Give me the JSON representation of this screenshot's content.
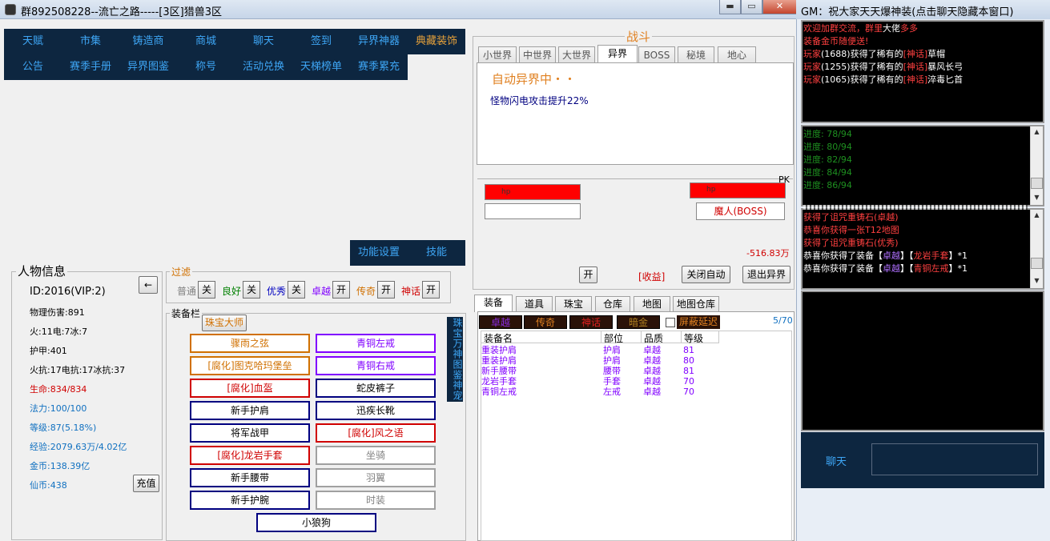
{
  "window": {
    "title": "群892508228--流亡之路-----[3区]猎兽3区",
    "min": "▬",
    "max": "▭",
    "close": "✕"
  },
  "menu": {
    "row1": [
      "天赋",
      "市集",
      "铸造商",
      "商城",
      "聊天",
      "签到",
      "异界神器",
      "典藏装饰"
    ],
    "row2": [
      "公告",
      "赛季手册",
      "异界图鉴",
      "称号",
      "活动兑换",
      "天梯榜单",
      "赛季累充"
    ]
  },
  "func": {
    "settings": "功能设置",
    "skills": "技能"
  },
  "character": {
    "title": "人物信息",
    "back": "←",
    "id": "ID:2016(VIP:2)",
    "phys": "物理伤害:891",
    "elem": "火:11电:7冰:7",
    "armor": "护甲:401",
    "resist": "火抗:17电抗:17冰抗:37",
    "hp": "生命:834/834",
    "mp": "法力:100/100",
    "level": "等级:87(5.18%)",
    "exp": "经验:2079.63万/4.02亿",
    "gold": "金币:138.39亿",
    "coin": "仙币:438",
    "recharge": "充值"
  },
  "filter": {
    "title": "过滤",
    "items": [
      {
        "label": "普通",
        "state": "关",
        "color": "#808080"
      },
      {
        "label": "良好",
        "state": "关",
        "color": "#008000"
      },
      {
        "label": "优秀",
        "state": "关",
        "color": "#0000c0"
      },
      {
        "label": "卓越",
        "state": "开",
        "color": "#8000ff"
      },
      {
        "label": "传奇",
        "state": "开",
        "color": "#d07000"
      },
      {
        "label": "神话",
        "state": "开",
        "color": "#d00000"
      }
    ]
  },
  "equip": {
    "title": "装备栏",
    "jeweler": "珠宝大师",
    "side": "珠宝万神图鉴神宠",
    "left": [
      {
        "label": "骤雨之弦",
        "color": "#d07000"
      },
      {
        "label": "[腐化]图克哈玛堡垒",
        "color": "#d07000"
      },
      {
        "label": "[腐化]血盔",
        "color": "#d00000"
      },
      {
        "label": "新手护肩",
        "color": "#000080"
      },
      {
        "label": "将军战甲",
        "color": "#000080"
      },
      {
        "label": "[腐化]龙岩手套",
        "color": "#d00000"
      },
      {
        "label": "新手腰带",
        "color": "#000080"
      },
      {
        "label": "新手护腕",
        "color": "#000080"
      }
    ],
    "right": [
      {
        "label": "青铜左戒",
        "color": "#8000ff"
      },
      {
        "label": "青铜右戒",
        "color": "#8000ff"
      },
      {
        "label": "蛇皮裤子",
        "color": "#000080"
      },
      {
        "label": "迅疾长靴",
        "color": "#000080"
      },
      {
        "label": "[腐化]风之语",
        "color": "#d00000"
      },
      {
        "label": "坐骑",
        "color": "#a0a0a0"
      },
      {
        "label": "羽翼",
        "color": "#a0a0a0"
      },
      {
        "label": "时装",
        "color": "#a0a0a0"
      }
    ],
    "pet": {
      "label": "小狼狗",
      "color": "#000080"
    }
  },
  "battle": {
    "title": "战斗",
    "tabs": [
      "小世界",
      "中世界",
      "大世界",
      "异界",
      "BOSS",
      "秘境",
      "地心"
    ],
    "status": "自动异界中・・",
    "buff": "怪物闪电攻击提升22%",
    "pk": "PK",
    "player_hp": "hp",
    "enemy_hp": "hp",
    "enemy_name": "魔人(BOSS)",
    "gain_value": "-516.83万",
    "open": "开",
    "income": "[收益]",
    "stop_auto": "关闭自动",
    "exit": "退出异界"
  },
  "inventory": {
    "tabs": [
      "装备",
      "道具",
      "珠宝",
      "仓库",
      "地图",
      "地图仓库"
    ],
    "quality": [
      {
        "label": "卓越",
        "color": "#8a2be2"
      },
      {
        "label": "传奇",
        "color": "#e08020"
      },
      {
        "label": "神话",
        "color": "#e02020"
      },
      {
        "label": "暗金",
        "color": "#b08020"
      }
    ],
    "hide_delay": "屏蔽延迟",
    "count": "5/70",
    "headers": [
      "装备名",
      "部位",
      "品质",
      "等级"
    ],
    "rows": [
      [
        "重装护肩",
        "护肩",
        "卓越",
        "81"
      ],
      [
        "重装护肩",
        "护肩",
        "卓越",
        "80"
      ],
      [
        "新手腰带",
        "腰带",
        "卓越",
        "81"
      ],
      [
        "龙岩手套",
        "手套",
        "卓越",
        "70"
      ],
      [
        "青铜左戒",
        "左戒",
        "卓越",
        "70"
      ]
    ]
  },
  "chat": {
    "title": "GM：祝大家天天爆神装(点击聊天隐藏本窗口)",
    "top": [
      [
        [
          "欢迎加群交流，群里",
          "#ff4040"
        ],
        [
          "大佬",
          "#ffffff"
        ],
        [
          "多多",
          "#ff4040"
        ]
      ],
      [
        [
          "装备金币随便送!",
          "#ff4040"
        ]
      ],
      [
        [
          "玩家",
          "#ff4040"
        ],
        [
          "(1688)获得了稀有的",
          "#ffffff"
        ],
        [
          "[神话]",
          "#ff4040"
        ],
        [
          "草帽",
          "#ffffff"
        ]
      ],
      [
        [
          "玩家",
          "#ff4040"
        ],
        [
          "(1255)获得了稀有的",
          "#ffffff"
        ],
        [
          "[神话]",
          "#ff4040"
        ],
        [
          "暴风长弓",
          "#ffffff"
        ]
      ],
      [
        [
          "玩家",
          "#ff4040"
        ],
        [
          "(1065)获得了稀有的",
          "#ffffff"
        ],
        [
          "[神话]",
          "#ff4040"
        ],
        [
          "淬毒匕首",
          "#ffffff"
        ]
      ]
    ],
    "progress": [
      "进度: 78/94",
      "进度: 80/94",
      "进度: 82/94",
      "进度: 84/94",
      "进度: 86/94"
    ],
    "drops": [
      [
        [
          "获得了诅咒重铸石(卓越)",
          "#ff4040"
        ]
      ],
      [
        [
          "恭喜你获得一张T12地图",
          "#ff4040"
        ]
      ],
      [
        [
          "获得了诅咒重铸石(优秀)",
          "#ff4040"
        ]
      ],
      [
        [
          "恭喜你获得了装备【",
          "#ffffff"
        ],
        [
          "卓越",
          "#b070ff"
        ],
        [
          "】【",
          "#ffffff"
        ],
        [
          "龙岩手套",
          "#ff4040"
        ],
        [
          "】*1",
          "#ffffff"
        ]
      ],
      [
        [
          "恭喜你获得了装备【",
          "#ffffff"
        ],
        [
          "卓越",
          "#b070ff"
        ],
        [
          "】【",
          "#ffffff"
        ],
        [
          "青铜左戒",
          "#ff4040"
        ],
        [
          "】*1",
          "#ffffff"
        ]
      ]
    ],
    "chat_label": "聊天"
  }
}
